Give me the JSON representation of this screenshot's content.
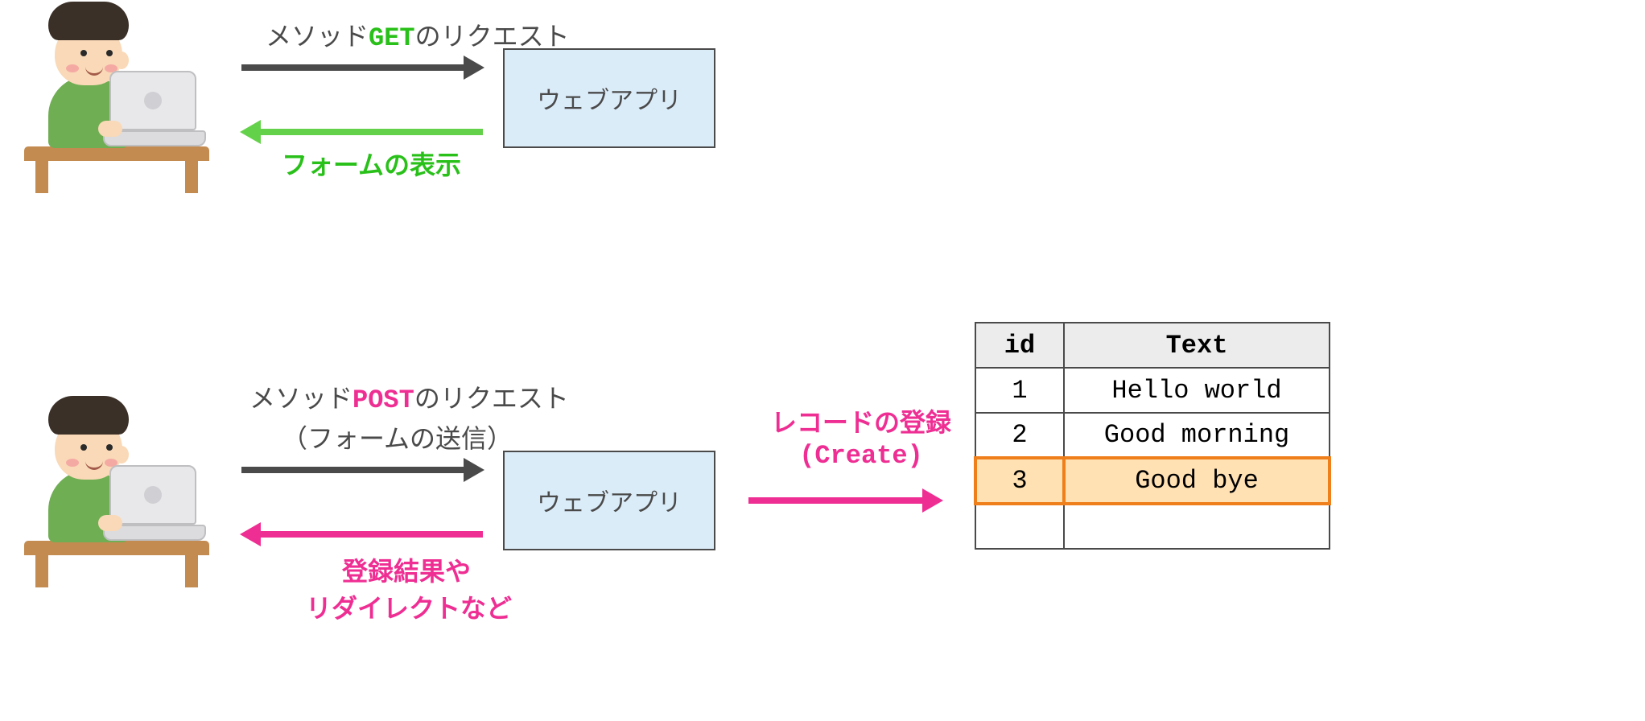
{
  "top": {
    "request_prefix": "メソッド",
    "request_method": "GET",
    "request_suffix": "のリクエスト",
    "webapp_label": "ウェブアプリ",
    "response_label": "フォームの表示"
  },
  "bottom": {
    "request_prefix": "メソッド",
    "request_method": "POST",
    "request_suffix": "のリクエスト",
    "request_sub": "（フォームの送信）",
    "webapp_label": "ウェブアプリ",
    "response_line1": "登録結果や",
    "response_line2": "リダイレクトなど",
    "db_action_line1": "レコードの登録",
    "db_action_line2": "(Create)"
  },
  "table": {
    "header_id": "id",
    "header_text": "Text",
    "rows": [
      {
        "id": "1",
        "text": "Hello world",
        "highlight": false
      },
      {
        "id": "2",
        "text": "Good morning",
        "highlight": false
      },
      {
        "id": "3",
        "text": "Good bye",
        "highlight": true
      },
      {
        "id": "",
        "text": "",
        "highlight": false
      }
    ]
  }
}
